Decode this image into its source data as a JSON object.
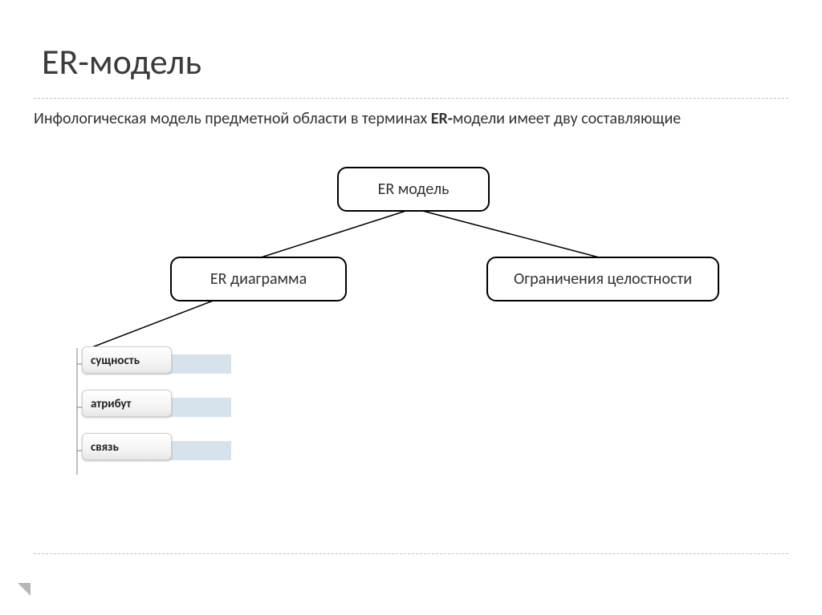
{
  "title": "ER-модель",
  "description_pre": "Инфологическая модель предметной области в терминах ",
  "description_bold": "ER-",
  "description_post": "модели имеет дву составляющие",
  "tree": {
    "root": "ER модель",
    "children": {
      "left": "ER диаграмма",
      "right": "Ограничения целостности"
    }
  },
  "subitems": [
    "сущность",
    "атрибут",
    "связь"
  ]
}
